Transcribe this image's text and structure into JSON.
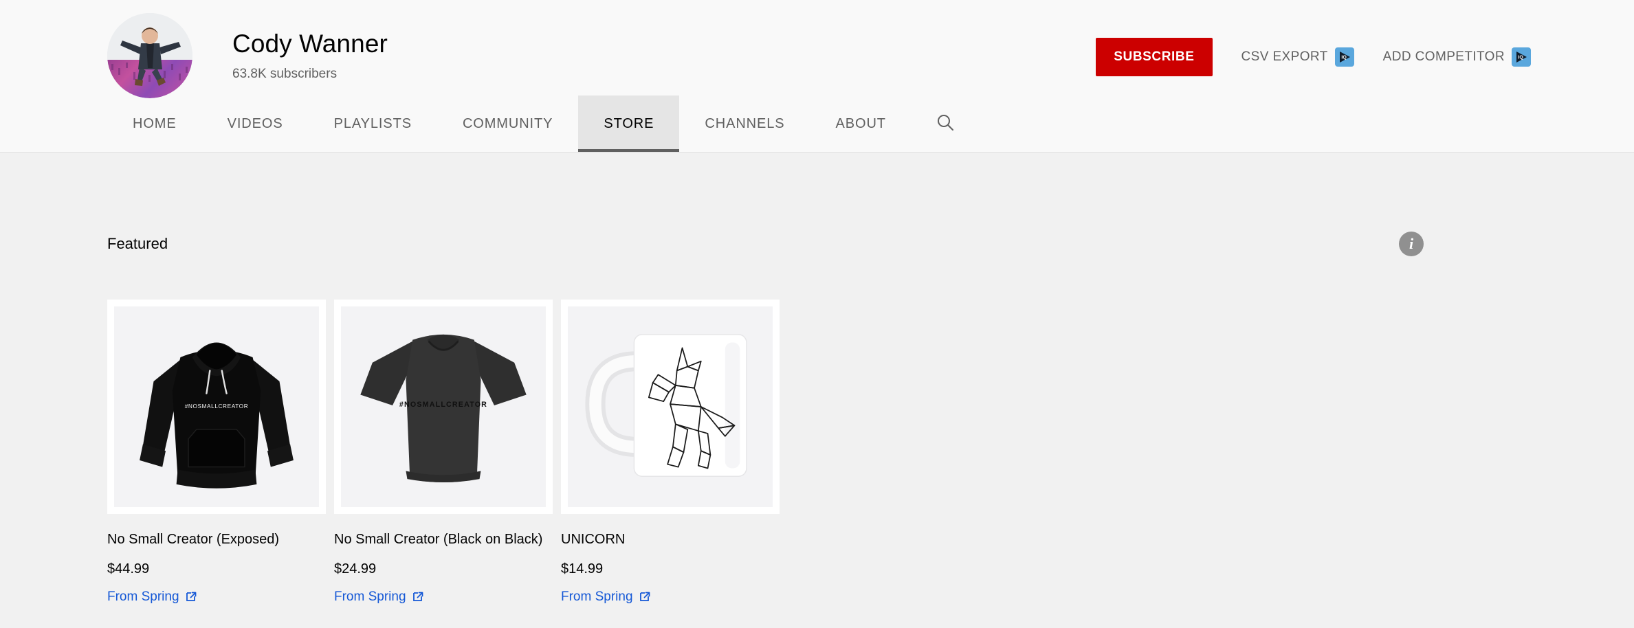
{
  "channel": {
    "name": "Cody Wanner",
    "subscribers": "63.8K subscribers",
    "avatar_icon": "channel-avatar-photo"
  },
  "header_actions": {
    "subscribe_label": "SUBSCRIBE",
    "subscribe_color": "#cc0000",
    "items": [
      {
        "label": "CSV EXPORT",
        "icon": "vidiq-icon"
      },
      {
        "label": "ADD COMPETITOR",
        "icon": "vidiq-icon"
      }
    ]
  },
  "tabs": [
    {
      "label": "HOME",
      "active": false
    },
    {
      "label": "VIDEOS",
      "active": false
    },
    {
      "label": "PLAYLISTS",
      "active": false
    },
    {
      "label": "COMMUNITY",
      "active": false
    },
    {
      "label": "STORE",
      "active": true
    },
    {
      "label": "CHANNELS",
      "active": false
    },
    {
      "label": "ABOUT",
      "active": false
    }
  ],
  "search": {
    "icon": "search-icon"
  },
  "store": {
    "section_title": "Featured",
    "info_icon": "info-icon",
    "info_glyph": "i",
    "products": [
      {
        "title": "No Small Creator (Exposed)",
        "price": "$44.99",
        "source": "From Spring",
        "image": "black-hoodie-nosmallcreator",
        "print_text": "#NOSMALLCREATOR"
      },
      {
        "title": "No Small Creator (Black on Black)",
        "price": "$24.99",
        "source": "From Spring",
        "image": "black-tshirt-nosmallcreator",
        "print_text": "#NOSMALLCREATOR"
      },
      {
        "title": "UNICORN",
        "price": "$14.99",
        "source": "From Spring",
        "image": "white-mug-unicorn",
        "print_text": ""
      }
    ]
  },
  "colors": {
    "header_bg": "#f9f9f9",
    "page_bg": "#f1f1f1",
    "link": "#1558d6",
    "active_tab_bg": "#e5e5e5",
    "vidiq_blue": "#5aa7dd"
  }
}
